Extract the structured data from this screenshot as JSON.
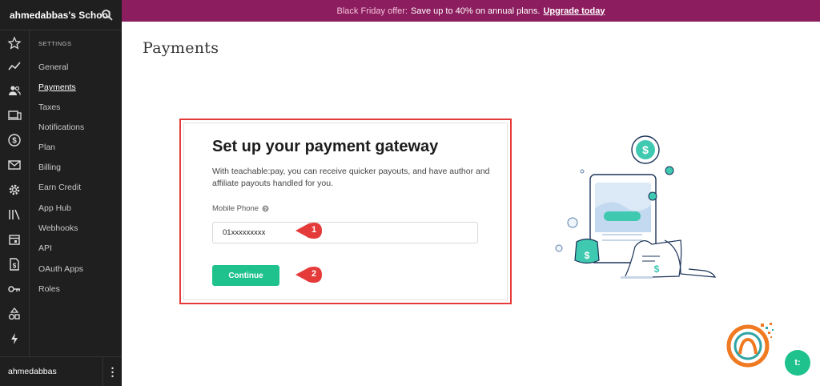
{
  "school": {
    "name": "ahmedabbas's School",
    "search_icon": "search-icon"
  },
  "user": {
    "name": "ahmedabbas",
    "menu_icon": "more-vertical-icon"
  },
  "rail_icons": [
    "star-icon",
    "trend-icon",
    "users-icon",
    "devices-icon",
    "dollar-circle-icon",
    "mail-icon",
    "gear-icon",
    "library-icon",
    "calendar-icon",
    "document-dollar-icon",
    "key-icon",
    "shapes-icon",
    "bolt-icon"
  ],
  "settings": {
    "heading": "SETTINGS",
    "items": [
      {
        "label": "General",
        "active": false
      },
      {
        "label": "Payments",
        "active": true
      },
      {
        "label": "Taxes",
        "active": false
      },
      {
        "label": "Notifications",
        "active": false
      },
      {
        "label": "Plan",
        "active": false
      },
      {
        "label": "Billing",
        "active": false
      },
      {
        "label": "Earn Credit",
        "active": false
      },
      {
        "label": "App Hub",
        "active": false
      },
      {
        "label": "Webhooks",
        "active": false
      },
      {
        "label": "API",
        "active": false
      },
      {
        "label": "OAuth Apps",
        "active": false
      },
      {
        "label": "Roles",
        "active": false
      }
    ]
  },
  "banner": {
    "label": "Black Friday offer:",
    "text": "Save up to 40% on annual plans.",
    "link": "Upgrade today",
    "color": "#8c1d5e"
  },
  "page": {
    "title": "Payments"
  },
  "gateway": {
    "title": "Set up your payment gateway",
    "description": "With teachable:pay, you can receive quicker payouts, and have author and affiliate payouts handled for you.",
    "phone_label": "Mobile Phone",
    "phone_value": "01xxxxxxxxx",
    "continue_label": "Continue",
    "accent": "#1fc28c"
  },
  "callouts": {
    "one": "1",
    "two": "2",
    "color": "#e53a3a"
  },
  "chat": {
    "label": "t:"
  }
}
